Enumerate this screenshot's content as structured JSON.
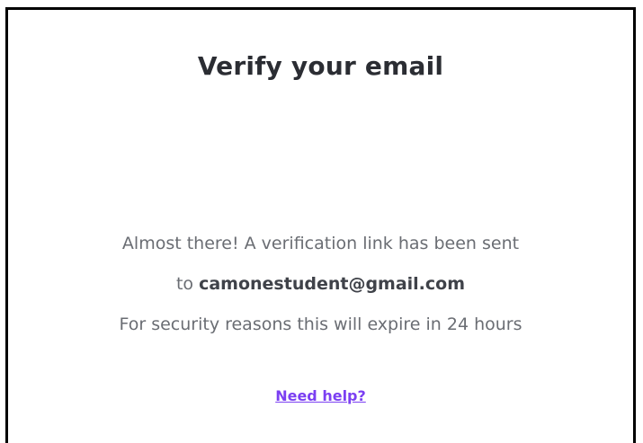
{
  "card": {
    "title": "Verify your email",
    "message": {
      "line1": "Almost there! A verification link has been sent",
      "line2_prefix": "to ",
      "email": "camonestudent@gmail.com",
      "line3": "For security reasons this will expire in 24 hours"
    },
    "help_link": "Need help?"
  },
  "colors": {
    "title": "#2b2d33",
    "body_text": "#6a6d73",
    "email_text": "#3f4249",
    "link": "#7b3ff2",
    "border": "#000000"
  }
}
